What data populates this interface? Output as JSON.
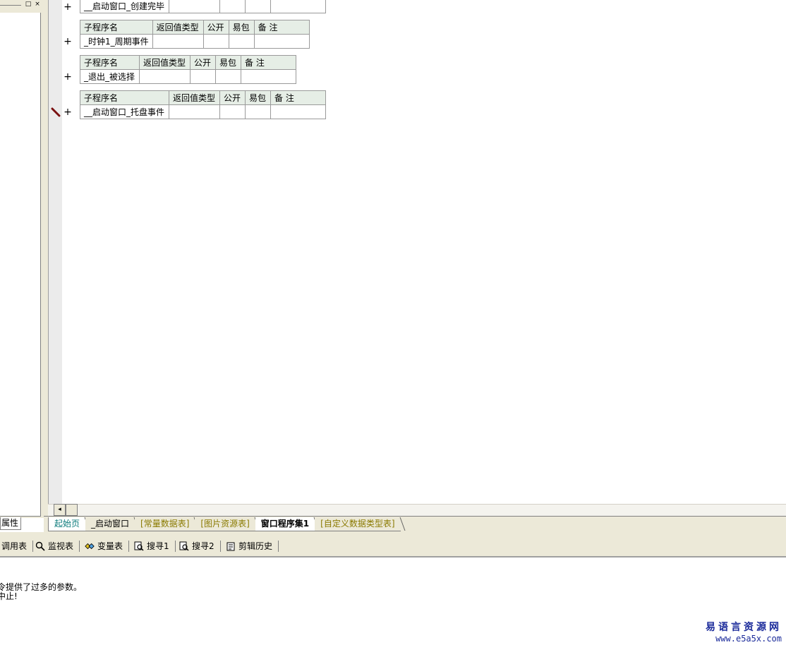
{
  "left_panel": {
    "tab_label": "属性",
    "restore_glyph": "□",
    "close_glyph": "×"
  },
  "editor": {
    "header_cols": [
      "子程序名",
      "返回值类型",
      "公开",
      "易包",
      "备 注"
    ],
    "plus_glyph": "+",
    "subroutines": [
      {
        "name": "__启动窗口_创建完毕"
      },
      {
        "name": "_时钟1_周期事件"
      },
      {
        "name": "_退出_被选择"
      },
      {
        "name": "__启动窗口_托盘事件"
      }
    ]
  },
  "hscroll": {
    "left_arrow": "◂"
  },
  "tabs": [
    {
      "label": "起始页"
    },
    {
      "label": "_启动窗口"
    },
    {
      "label": "[常量数据表]"
    },
    {
      "label": "[图片资源表]"
    },
    {
      "label": "窗口程序集1"
    },
    {
      "label": "[自定义数据类型表]"
    }
  ],
  "toolbar": {
    "items": [
      {
        "label": "调用表",
        "icon": "none"
      },
      {
        "label": "监视表",
        "icon": "magnifier-icon"
      },
      {
        "label": "变量表",
        "icon": "variables-icon"
      },
      {
        "label": "搜寻1",
        "icon": "search-doc-icon"
      },
      {
        "label": "搜寻2",
        "icon": "search-doc-icon"
      },
      {
        "label": "剪辑历史",
        "icon": "clipboard-icon"
      }
    ]
  },
  "output": {
    "lines": [
      "令提供了过多的参数。",
      "中止!"
    ]
  },
  "watermark": {
    "title": "易语言资源网",
    "url": "www.e5a5x.com"
  },
  "colors": {
    "header_bg": "#e6eee6",
    "tab_first_color": "#0a7a7a",
    "tab_olive_color": "#8a7a00",
    "watermark_color": "#1a2a9a"
  }
}
